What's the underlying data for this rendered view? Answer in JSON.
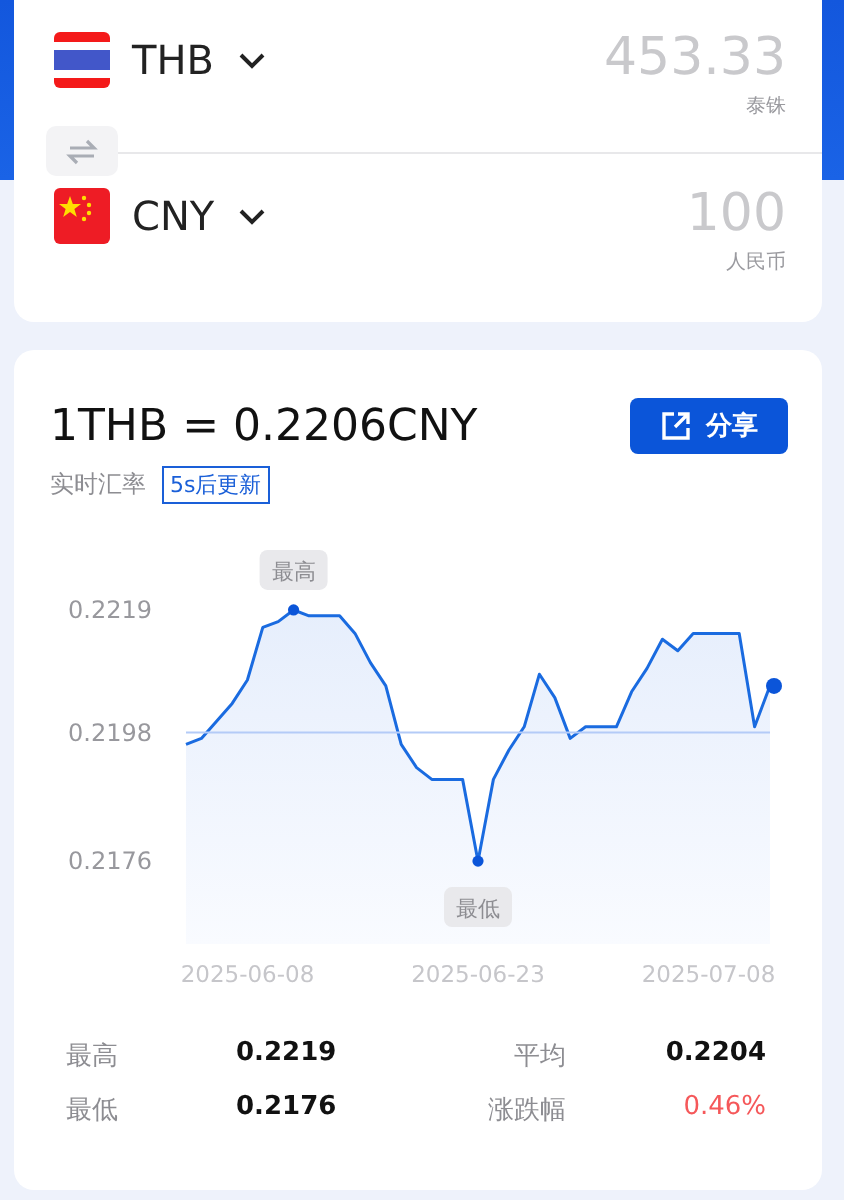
{
  "converter": {
    "rows": [
      {
        "code": "THB",
        "kind": "thailand",
        "amount": "453.33",
        "currency_name": "泰铢"
      },
      {
        "code": "CNY",
        "kind": "china",
        "amount": "100",
        "currency_name": "人民币"
      }
    ]
  },
  "rate": {
    "title": "1THB = 0.2206CNY",
    "share_button": "分享",
    "subtitle": "实时汇率",
    "refresh_badge": "5s后更新",
    "chart_data": {
      "type": "area",
      "categories": [
        null,
        null,
        null,
        null,
        "2025-06-08",
        null,
        null,
        null,
        null,
        null,
        null,
        null,
        null,
        null,
        null,
        null,
        null,
        null,
        null,
        "2025-06-23",
        null,
        null,
        null,
        null,
        null,
        null,
        null,
        null,
        null,
        null,
        null,
        null,
        null,
        null,
        "2025-07-08",
        null,
        null,
        null,
        null
      ],
      "series": [
        {
          "color": "#1a6be0",
          "values": [
            0.2196,
            0.2197,
            0.22,
            0.2203,
            0.2207,
            0.2216,
            0.2217,
            0.2219,
            0.2218,
            0.2218,
            0.2218,
            0.2215,
            0.221,
            0.2206,
            0.2196,
            0.2192,
            0.219,
            0.219,
            0.219,
            0.2176,
            0.219,
            0.2195,
            0.2199,
            0.2208,
            0.2204,
            0.2197,
            0.2199,
            0.2199,
            0.2199,
            0.2205,
            0.2209,
            0.2214,
            0.2212,
            0.2215,
            0.2215,
            0.2215,
            0.2215,
            0.2199,
            0.2206
          ]
        }
      ],
      "ylim": [
        0.2176,
        0.2219
      ],
      "yticks": [
        0.2176,
        0.2198,
        0.2219
      ],
      "ref_lines": [
        {
          "axis": "y",
          "value": 0.2198
        }
      ],
      "annotations": [
        {
          "text": "最高",
          "y": 0.2219
        },
        {
          "text": "最低",
          "y": 0.2176
        }
      ]
    },
    "stats": [
      {
        "label": "最高",
        "value": "0.2219",
        "kind": "value"
      },
      {
        "label": "平均",
        "value": "0.2204",
        "kind": "value"
      },
      {
        "label": "最低",
        "value": "0.2176",
        "kind": "value"
      },
      {
        "label": "涨跌幅",
        "value": "0.46%",
        "kind": "change"
      }
    ]
  }
}
